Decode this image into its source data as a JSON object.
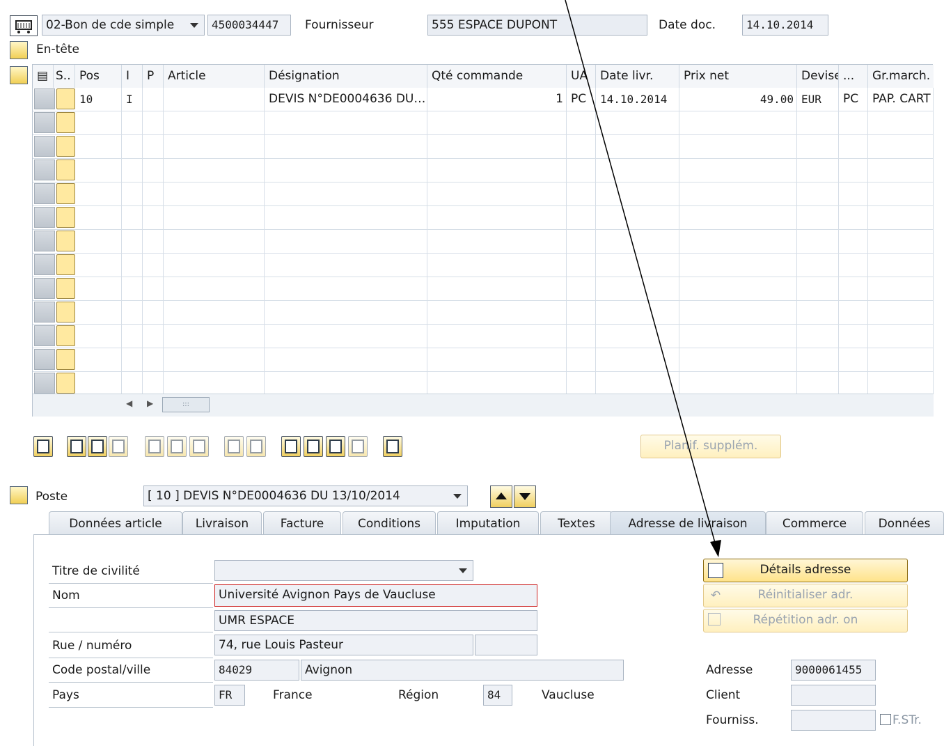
{
  "header": {
    "doc_type": "02-Bon de cde simple",
    "po_number": "4500034447",
    "supplier_label": "Fournisseur",
    "supplier_value": "555 ESPACE DUPONT",
    "date_label": "Date doc.",
    "date_value": "14.10.2014",
    "section_header": "En-tête"
  },
  "table": {
    "columns": [
      "S..",
      "Pos",
      "I",
      "P",
      "Article",
      "Désignation",
      "Qté commande",
      "UA",
      "Date livr.",
      "Prix net",
      "Devise",
      "...",
      "Gr.march."
    ],
    "rows": [
      {
        "pos": "10",
        "i": "I",
        "p": "",
        "article": "",
        "designation": "DEVIS N°DE0004636 DU…",
        "qty": "1",
        "ua": "PC",
        "date": "14.10.2014",
        "price": "49.00",
        "currency": "EUR",
        "dots": "PC",
        "group": "PAP. CART"
      }
    ],
    "empty_rows": 12,
    "scroll_hint": ":::"
  },
  "actions": {
    "plan_label": "Planif. supplém."
  },
  "item": {
    "label": "Poste",
    "selected": "[ 10 ] DEVIS N°DE0004636 DU 13/10/2014"
  },
  "tabs": [
    "Données article",
    "Livraison",
    "Facture",
    "Conditions",
    "Imputation",
    "Textes",
    "Adresse de livraison",
    "Commerce",
    "Données"
  ],
  "address": {
    "title_label": "Titre de civilité",
    "title_value": "",
    "name_label": "Nom",
    "name_value": "Université Avignon Pays de Vaucluse",
    "name2_value": "UMR ESPACE",
    "street_label": "Rue / numéro",
    "street_value": "74, rue Louis Pasteur",
    "house_value": "",
    "postal_label": "Code postal/ville",
    "postal_value": "84029",
    "city_value": "Avignon",
    "country_label": "Pays",
    "country_code": "FR",
    "country_name": "France",
    "region_label": "Région",
    "region_code": "84",
    "region_name": "Vaucluse",
    "details_button": "Détails adresse",
    "reset_button": "Réinitialiser adr.",
    "repeat_button": "Répétition adr. on",
    "address_no_label": "Adresse",
    "address_no_value": "9000061455",
    "client_label": "Client",
    "client_value": "",
    "supplier_label": "Fourniss.",
    "supplier_value": "",
    "fstr_label": "F.STr."
  },
  "colors": {
    "accent_yellow": "#ffe38a",
    "panel_blue": "#dfe5ec"
  }
}
